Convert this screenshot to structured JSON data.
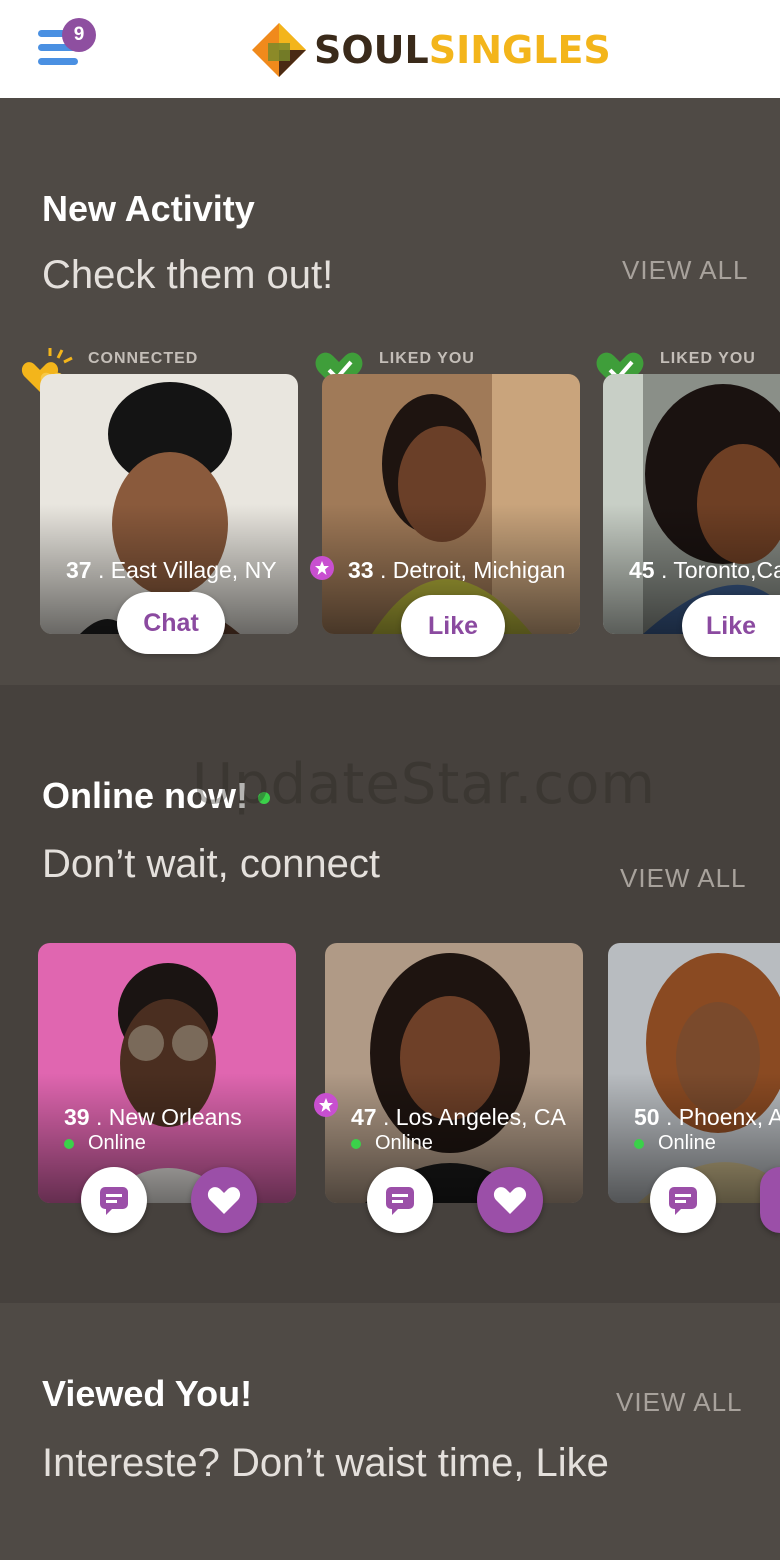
{
  "header": {
    "menu_badge": "9",
    "logo_part1": "SOUL",
    "logo_part2": "SINGLES"
  },
  "new_activity": {
    "title": "New Activity",
    "subtitle": "Check them out!",
    "view_all": "VIEW ALL",
    "cards": [
      {
        "tag": "CONNECTED",
        "age": "37",
        "location": " . East Village, NY",
        "action": "Chat"
      },
      {
        "tag": "LIKED YOU",
        "age": "33",
        "location": " . Detroit, Michigan",
        "action": "Like"
      },
      {
        "tag": "LIKED YOU",
        "age": "45",
        "location": " . Toronto,Ca",
        "action": "Like"
      }
    ]
  },
  "online_now": {
    "title": "Online now!",
    "subtitle": "Don’t wait, connect",
    "view_all": "VIEW ALL",
    "cards": [
      {
        "age": "39",
        "location": " . New Orleans",
        "status": "Online"
      },
      {
        "age": "47",
        "location": " . Los Angeles, CA",
        "status": "Online"
      },
      {
        "age": "50",
        "location": " . Phoenx, A",
        "status": "Online"
      }
    ]
  },
  "viewed_you": {
    "title": "Viewed You!",
    "subtitle": "Intereste? Don’t waist time, Like",
    "view_all": "VIEW ALL"
  },
  "watermark": "UpdateStar.com",
  "colors": {
    "accent_purple": "#9b4fa8",
    "logo_orange": "#f3b51b",
    "online_green": "#3bd14a",
    "menu_blue": "#4a90e2"
  }
}
